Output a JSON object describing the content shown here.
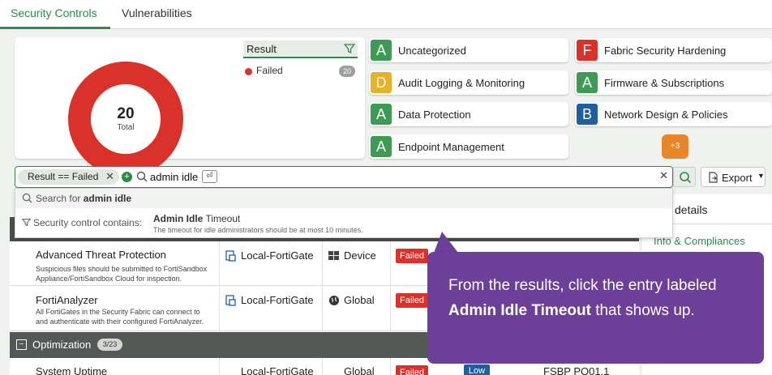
{
  "tabs": [
    "Security Controls",
    "Vulnerabilities"
  ],
  "summary": {
    "total_value": "20",
    "total_label": "Total",
    "filter_header": "Result",
    "legend_label": "Failed",
    "legend_count": "20",
    "colors": {
      "failed": "#d9322a",
      "accent": "#2f8a47"
    }
  },
  "categories": [
    {
      "grade": "A",
      "label": "Uncategorized",
      "color": "#3f9a56"
    },
    {
      "grade": "D",
      "label": "Audit Logging & Monitoring",
      "color": "#e8b12c"
    },
    {
      "grade": "A",
      "label": "Data Protection",
      "color": "#3f9a56"
    },
    {
      "grade": "A",
      "label": "Endpoint Management",
      "color": "#3f9a56"
    },
    {
      "grade": "F",
      "label": "Fabric Security Hardening",
      "color": "#d9322a"
    },
    {
      "grade": "A",
      "label": "Firmware & Subscriptions",
      "color": "#3f9a56"
    },
    {
      "grade": "B",
      "label": "Network Design & Policies",
      "color": "#1f5fa0"
    }
  ],
  "more_label": "+3",
  "search": {
    "chip": "Result == Failed",
    "query": "admin idle",
    "enter_key": "⏎",
    "clear": "✕",
    "export": "Export"
  },
  "dropdown": {
    "row1_prefix": "Search for ",
    "row1_term": "admin idle",
    "row2_prefix": "Security control contains: ",
    "row2_match": "Admin Idle",
    "row2_rest": " Timeout",
    "row2_desc": "The timeout for idle administrators should be at most 10 minutes."
  },
  "right_panel": {
    "tab": "details",
    "link": "Info & Compliances"
  },
  "rows": [
    {
      "title": "Advanced Threat Protection",
      "desc1": "Suspicious files should be submitted to FortiSandbox",
      "desc2": "Appliance/FortiSandbox Cloud for inspection.",
      "device": "Local-FortiGate",
      "scope": "Device",
      "result": "Failed"
    },
    {
      "title": "FortiAnalyzer",
      "desc1": "All FortiGates in the Security Fabric can connect to",
      "desc2": "and authenticate with their configured FortiAnalyzer.",
      "device": "Local-FortiGate",
      "scope": "Global",
      "result": "Failed"
    }
  ],
  "group": {
    "label": "Optimization",
    "count": "3/23"
  },
  "last_row": {
    "title": "System Uptime",
    "device": "Local-FortiGate",
    "scope": "Global",
    "result": "Failed",
    "severity": "Low",
    "ref": "FSBP PO01.1"
  },
  "tooltip": {
    "line_a": "From the results, click the entry labeled ",
    "bold": "Admin Idle Timeout",
    "line_b": " that shows up."
  }
}
